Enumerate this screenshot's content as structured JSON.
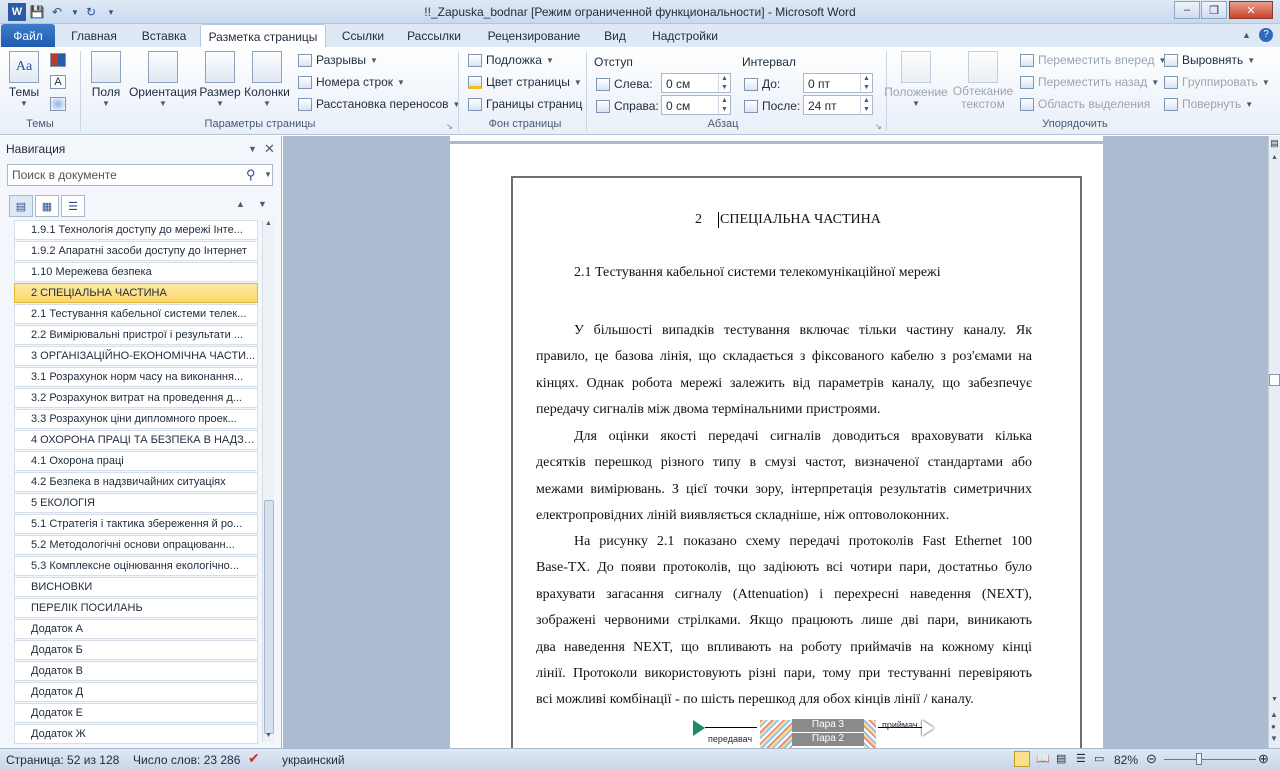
{
  "window": {
    "title": "!!_Zapuska_bodnar [Режим ограниченной функциональности]  -  Microsoft Word"
  },
  "tabs": [
    "Файл",
    "Главная",
    "Вставка",
    "Разметка страницы",
    "Ссылки",
    "Рассылки",
    "Рецензирование",
    "Вид",
    "Надстройки"
  ],
  "ribbon": {
    "themes": {
      "themes": "Темы",
      "group": "Темы"
    },
    "page_setup": {
      "fields": "Поля",
      "orientation": "Ориентация",
      "size": "Размер",
      "columns": "Колонки",
      "breaks": "Разрывы",
      "line_numbers": "Номера строк",
      "hyphenation": "Расстановка переносов",
      "group": "Параметры страницы"
    },
    "background": {
      "watermark": "Подложка",
      "page_color": "Цвет страницы",
      "page_borders": "Границы страниц",
      "group": "Фон страницы"
    },
    "paragraph": {
      "indent": "Отступ",
      "left": "Слева:",
      "left_val": "0 см",
      "right": "Справа:",
      "right_val": "0 см",
      "spacing": "Интервал",
      "before": "До:",
      "before_val": "0 пт",
      "after": "После:",
      "after_val": "24 пт",
      "group": "Абзац"
    },
    "arrange": {
      "position": "Положение",
      "wrap": "Обтекание текстом",
      "bring_forward": "Переместить вперед",
      "send_backward": "Переместить назад",
      "selection_pane": "Область выделения",
      "align": "Выровнять",
      "group_btn": "Группировать",
      "rotate": "Повернуть",
      "group": "Упорядочить"
    }
  },
  "navigation": {
    "title": "Навигация",
    "search_placeholder": "Поиск в документе",
    "items": [
      "1.9.1 Технологія доступу до мережі Інте...",
      "1.9.2 Апаратні засоби доступу до Інтернет",
      "1.10 Мережева безпека",
      "2 СПЕЦІАЛЬНА ЧАСТИНА",
      "2.1 Тестування кабельної системи телек...",
      "2.2 Вимірювальні пристрої і результати ...",
      "3 ОРГАНІЗАЦІЙНО-ЕКОНОМІЧНА ЧАСТИ...",
      "3.1 Розрахунок норм часу на виконання...",
      "3.2 Розрахунок витрат на проведення д...",
      "3.3 Розрахунок ціни дипломного проек...",
      "4 ОХОРОНА ПРАЦІ ТА БЕЗПЕКА В НАДЗВ...",
      "4.1 Охорона праці",
      "4.2 Безпека в надзвичайних ситуаціях",
      "5 ЕКОЛОГІЯ",
      "5.1 Стратегія і тактика збереження й ро...",
      "5.2 Методологічні основи опрацюванн...",
      "5.3 Комплексне оцінювання екологічно...",
      "ВИСНОВКИ",
      "ПЕРЕЛІК ПОСИЛАНЬ",
      "Додаток А",
      "Додаток Б",
      "Додаток В",
      "Додаток Д",
      "Додаток Е",
      "Додаток Ж"
    ],
    "selected_index": 3
  },
  "document": {
    "heading_num": "2",
    "heading": "СПЕЦІАЛЬНА ЧАСТИНА",
    "subheading": "2.1 Тестування кабельної системи телекомунікаційної мережі",
    "p1": [
      "У більшості випадків тестування включає тільки частину каналу. Як",
      "правило, це базова лінія, що складається з фіксованого кабелю з роз'ємами на",
      "кінцях. Однак робота мережі залежить від параметрів каналу, що забезпечує",
      "передачу сигналів між двома термінальними пристроями."
    ],
    "p2": [
      "Для оцінки якості передачі сигналів доводиться враховувати кілька",
      "десятків перешкод різного типу в смузі частот, визначеної стандартами або",
      "межами вимірювань. З цієї точки зору, інтерпретація результатів симетричних",
      "електропровідних ліній виявляється складніше, ніж оптоволоконних."
    ],
    "p3": [
      "На рисунку 2.1 показано схему передачі протоколів Fast Ethernet 100",
      "Base-TX. До появи протоколів, що задіюють всі чотири пари, достатньо було",
      "врахувати загасання сигналу (Attenuation) і перехресні наведення (NEXT),",
      "зображені червоними стрілками. Якщо працюють лише дві пари, виникають",
      "два наведення NEXT, що впливають на роботу приймачів на кожному кінці",
      "лінії. Протоколи використовують різні пари, тому при тестуванні перевіряють",
      "всі можливі комбінації - по шість перешкод для обох кінців лінії / каналу."
    ],
    "figure": {
      "tx": "передавач",
      "rx": "приймач",
      "pair3": "Пара 3",
      "pair2": "Пара 2"
    }
  },
  "status": {
    "page": "Страница: 52 из 128",
    "words": "Число слов: 23 286",
    "language": "украинский",
    "zoom": "82%"
  }
}
